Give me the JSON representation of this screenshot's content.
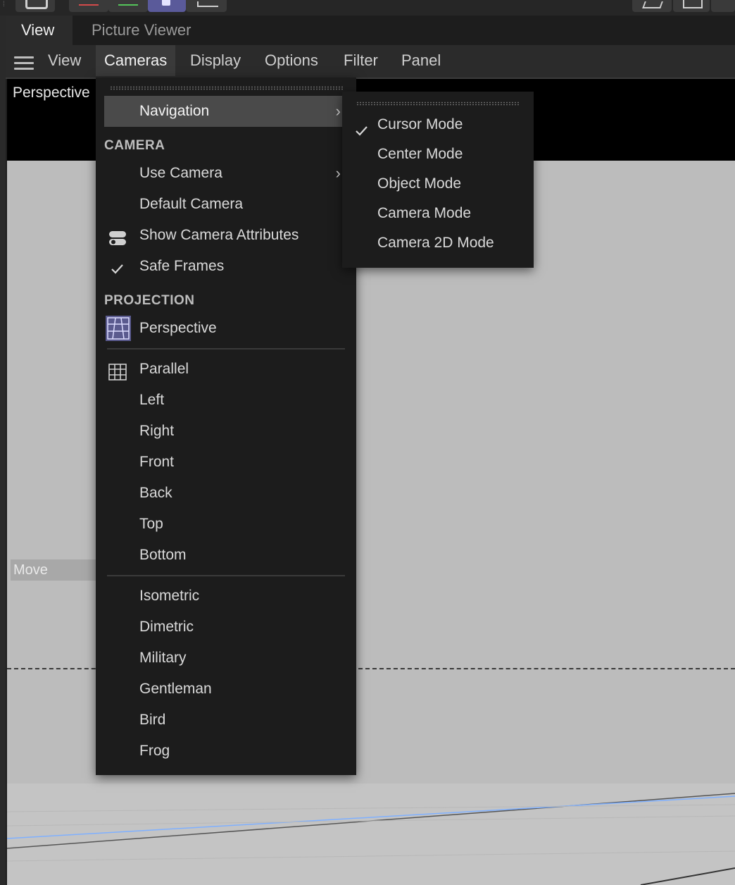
{
  "tabs": [
    {
      "label": "View",
      "active": true
    },
    {
      "label": "Picture Viewer",
      "active": false
    }
  ],
  "menubar": {
    "items": [
      "View",
      "Cameras",
      "Display",
      "Options",
      "Filter",
      "Panel"
    ],
    "open_item": "Cameras"
  },
  "viewport": {
    "camera_label": "Perspective",
    "move_label": "Move"
  },
  "cameras_menu": {
    "navigation": "Navigation",
    "camera_header": "CAMERA",
    "use_camera": "Use Camera",
    "default_camera": "Default Camera",
    "show_camera_attributes": "Show Camera Attributes",
    "safe_frames": "Safe Frames",
    "projection_header": "PROJECTION",
    "perspective": "Perspective",
    "parallel": "Parallel",
    "left": "Left",
    "right": "Right",
    "front": "Front",
    "back": "Back",
    "top": "Top",
    "bottom": "Bottom",
    "isometric": "Isometric",
    "dimetric": "Dimetric",
    "military": "Military",
    "gentleman": "Gentleman",
    "bird": "Bird",
    "frog": "Frog"
  },
  "navigation_submenu": {
    "items": [
      "Cursor Mode",
      "Center Mode",
      "Object Mode",
      "Camera Mode",
      "Camera 2D Mode"
    ],
    "checked": "Cursor Mode"
  },
  "colors": {
    "menu_bg": "#1c1c1c",
    "highlight": "#4a4a4a",
    "viewport": "#bcbcbc",
    "perspective_icon": "#5a5a8e"
  }
}
